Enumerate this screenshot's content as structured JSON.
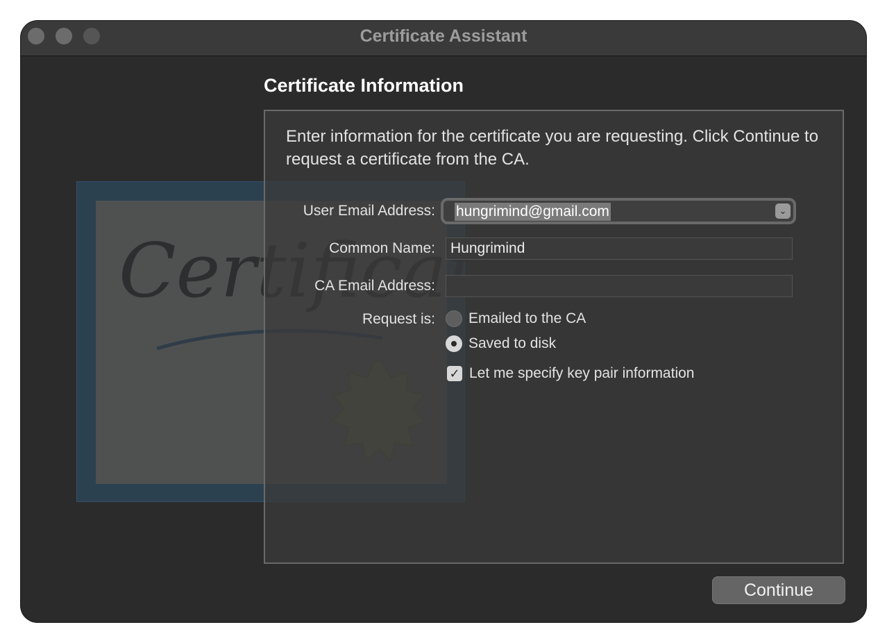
{
  "window": {
    "title": "Certificate Assistant"
  },
  "main": {
    "section_title": "Certificate Information",
    "intro": "Enter information for the certificate you are requesting. Click Continue to request a certificate from the CA.",
    "fields": {
      "user_email": {
        "label": "User Email Address:",
        "value": "hungrimind@gmail.com"
      },
      "common_name": {
        "label": "Common Name:",
        "value": "Hungrimind"
      },
      "ca_email": {
        "label": "CA Email Address:",
        "value": ""
      }
    },
    "request": {
      "label": "Request is:",
      "options": [
        {
          "label": "Emailed to the CA",
          "selected": false
        },
        {
          "label": "Saved to disk",
          "selected": true
        }
      ]
    },
    "key_pair_checkbox": {
      "label": "Let me specify key pair information",
      "checked": true
    }
  },
  "footer": {
    "continue_label": "Continue"
  },
  "artwork": {
    "certificate_text": "Certificate"
  },
  "icons": {
    "combo_arrow": "chevron-down-icon",
    "checkbox_mark": "checkmark-icon"
  },
  "colors": {
    "window_bg": "#2b2b2b",
    "titlebar_bg": "#3a3a3a",
    "panel_border": "#6a6a6a",
    "text": "#e3e3e3"
  }
}
